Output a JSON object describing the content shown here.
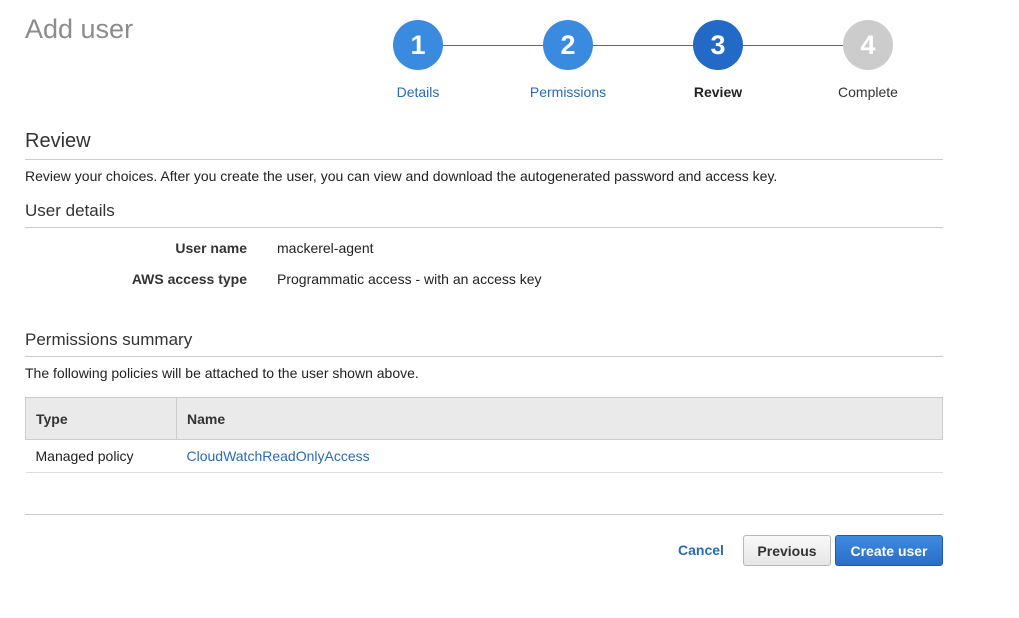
{
  "page": {
    "title": "Add user"
  },
  "stepper": {
    "steps": [
      {
        "number": "1",
        "label": "Details",
        "state": "done"
      },
      {
        "number": "2",
        "label": "Permissions",
        "state": "done"
      },
      {
        "number": "3",
        "label": "Review",
        "state": "active"
      },
      {
        "number": "4",
        "label": "Complete",
        "state": "todo"
      }
    ]
  },
  "review": {
    "heading": "Review",
    "description": "Review your choices. After you create the user, you can view and download the autogenerated password and access key."
  },
  "user_details": {
    "heading": "User details",
    "fields": [
      {
        "label": "User name",
        "value": "mackerel-agent"
      },
      {
        "label": "AWS access type",
        "value": "Programmatic access - with an access key"
      }
    ]
  },
  "permissions_summary": {
    "heading": "Permissions summary",
    "description": "The following policies will be attached to the user shown above.",
    "columns": [
      "Type",
      "Name"
    ],
    "rows": [
      {
        "type": "Managed policy",
        "name": "CloudWatchReadOnlyAccess"
      }
    ]
  },
  "actions": {
    "cancel_label": "Cancel",
    "previous_label": "Previous",
    "create_label": "Create user"
  },
  "colors": {
    "accent": "#2369c6",
    "step_done": "#3a8ae0",
    "step_todo": "#cccccc",
    "link": "#2a6ab8"
  }
}
